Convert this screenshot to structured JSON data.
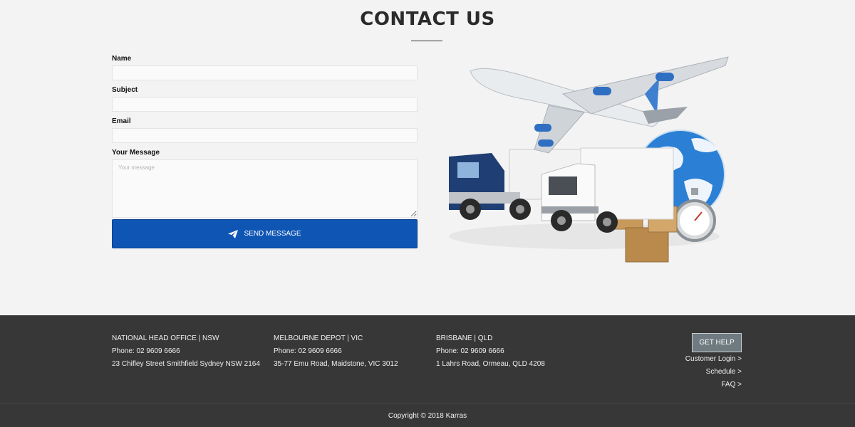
{
  "page": {
    "title": "CONTACT US"
  },
  "form": {
    "name_label": "Name",
    "subject_label": "Subject",
    "email_label": "Email",
    "message_label": "Your Message",
    "message_placeholder": "Your message",
    "submit_label": "SEND MESSAGE"
  },
  "footer": {
    "offices": [
      {
        "name": "NATIONAL HEAD OFFICE | NSW",
        "phone": "Phone: 02 9609 6666",
        "address": "23 Chifley Street Smithfield Sydney NSW 2164"
      },
      {
        "name": "MELBOURNE DEPOT | VIC",
        "phone": "Phone: 02 9609 6666",
        "address": "35-77 Emu Road, Maidstone, VIC 3012"
      },
      {
        "name": "BRISBANE | QLD",
        "phone": "Phone: 02 9609 6666",
        "address": "1 Lahrs Road, Ormeau, QLD 4208"
      }
    ],
    "help_button": "GET HELP",
    "links": [
      "Customer Login >",
      "Schedule >",
      "FAQ >"
    ],
    "copyright": "Copyright © 2018 Karras"
  },
  "colors": {
    "accent": "#0f55b4",
    "footer_bg": "#373737",
    "page_bg": "#f3f3f3"
  }
}
